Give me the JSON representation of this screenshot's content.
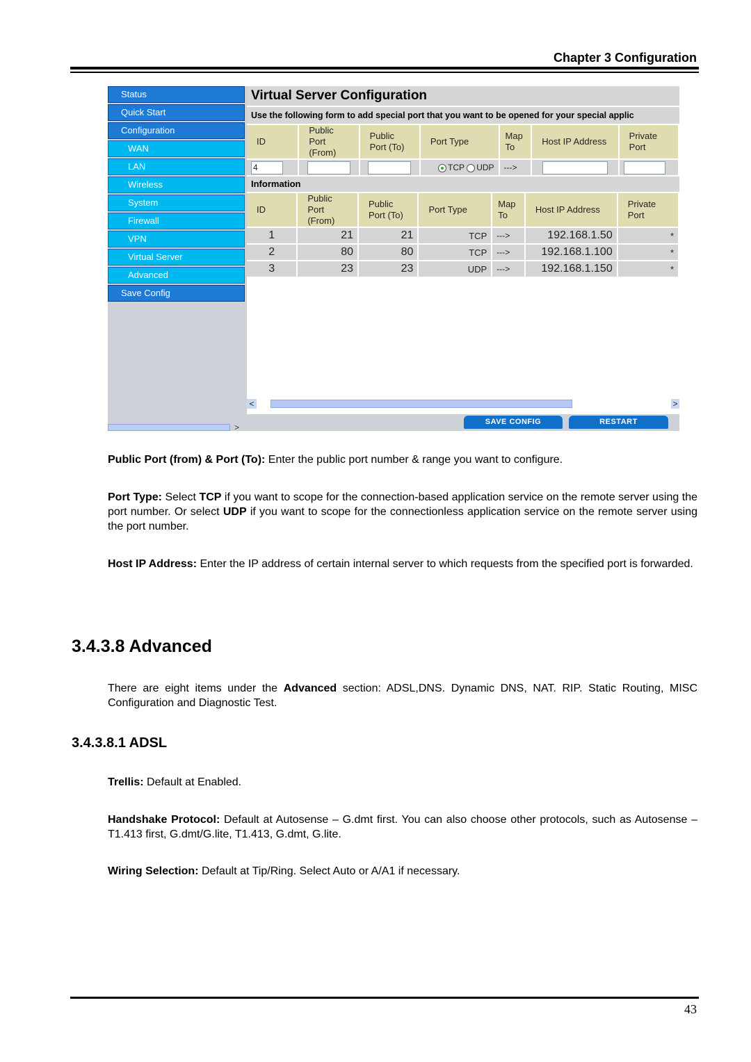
{
  "header": {
    "chapter": "Chapter 3 Configuration"
  },
  "screenshot": {
    "sidebar": [
      {
        "label": "Status",
        "level": "top"
      },
      {
        "label": "Quick Start",
        "level": "top"
      },
      {
        "label": "Configuration",
        "level": "top"
      },
      {
        "label": "WAN",
        "level": "sub"
      },
      {
        "label": "LAN",
        "level": "sub"
      },
      {
        "label": "Wireless",
        "level": "sub"
      },
      {
        "label": "System",
        "level": "sub"
      },
      {
        "label": "Firewall",
        "level": "sub"
      },
      {
        "label": "VPN",
        "level": "sub"
      },
      {
        "label": "Virtual Server",
        "level": "sub"
      },
      {
        "label": "Advanced",
        "level": "sub"
      },
      {
        "label": "Save Config",
        "level": "top"
      }
    ],
    "title": "Virtual Server Configuration",
    "description": "Use the following form to add special port that you want to be opened for your special applic",
    "columns": [
      "ID",
      "Public Port (From)",
      "Public Port (To)",
      "Port Type",
      "Map To",
      "Host IP Address",
      "Private Port"
    ],
    "column_lines": [
      [
        "ID"
      ],
      [
        "Public",
        "Port",
        "(From)"
      ],
      [
        "Public",
        "Port (To)"
      ],
      [
        "Port Type"
      ],
      [
        "Map",
        "To"
      ],
      [
        "Host IP Address"
      ],
      [
        "Private",
        "Port"
      ]
    ],
    "form": {
      "id_value": "4",
      "public_from_value": "",
      "public_to_value": "",
      "port_type_options": [
        "TCP",
        "UDP"
      ],
      "port_type_selected": "TCP",
      "map_to": "--->",
      "host_ip_value": "",
      "private_port_value": ""
    },
    "info_label": "Information",
    "rows": [
      {
        "id": "1",
        "from": "21",
        "to": "21",
        "type": "TCP",
        "map": "--->",
        "ip": "192.168.1.50",
        "private": "*"
      },
      {
        "id": "2",
        "from": "80",
        "to": "80",
        "type": "TCP",
        "map": "--->",
        "ip": "192.168.1.100",
        "private": "*"
      },
      {
        "id": "3",
        "from": "23",
        "to": "23",
        "type": "UDP",
        "map": "--->",
        "ip": "192.168.1.150",
        "private": "*"
      }
    ],
    "buttons": {
      "save": "SAVE CONFIG",
      "restart": "RESTART"
    },
    "scroll_left": "<",
    "scroll_right": ">",
    "colors": {
      "nav_top": "#1f7ad6",
      "nav_sub": "#00b8f0",
      "header_cell": "#dedcb0",
      "row_cell": "#d4d4d4",
      "button": "#1070c8"
    }
  },
  "paragraphs": {
    "public_port": {
      "label": "Public Port (from) & Port (To):",
      "text": " Enter the public port number & range you want to configure."
    },
    "port_type": {
      "label": "Port Type:",
      "t1": " Select ",
      "b1": "TCP",
      "t2": " if you want to scope for the connection-based application service on the remote server using the port number. Or select ",
      "b2": "UDP",
      "t3": " if you want to scope for the connectionless application service on the remote server using the port number."
    },
    "host_ip": {
      "label": "Host IP Address:",
      "text": " Enter the IP address of certain internal server to which requests from the specified port is forwarded."
    }
  },
  "section": {
    "heading": "3.4.3.8 Advanced",
    "intro_t1": "There are eight items under the ",
    "intro_b": "Advanced",
    "intro_t2": " section: ADSL,DNS. Dynamic DNS, NAT. RIP. Static Routing, MISC Configuration and Diagnostic Test.",
    "sub_heading": "3.4.3.8.1 ADSL",
    "trellis": {
      "label": "Trellis:",
      "text": " Default at Enabled."
    },
    "handshake": {
      "label": "Handshake Protocol:",
      "text": " Default at Autosense – G.dmt first. You can also choose other protocols, such as Autosense – T1.413 first, G.dmt/G.lite, T1.413, G.dmt, G.lite."
    },
    "wiring": {
      "label": "Wiring Selection:",
      "text": " Default at Tip/Ring. Select Auto or A/A1 if necessary."
    }
  },
  "footer": {
    "page_number": "43"
  }
}
